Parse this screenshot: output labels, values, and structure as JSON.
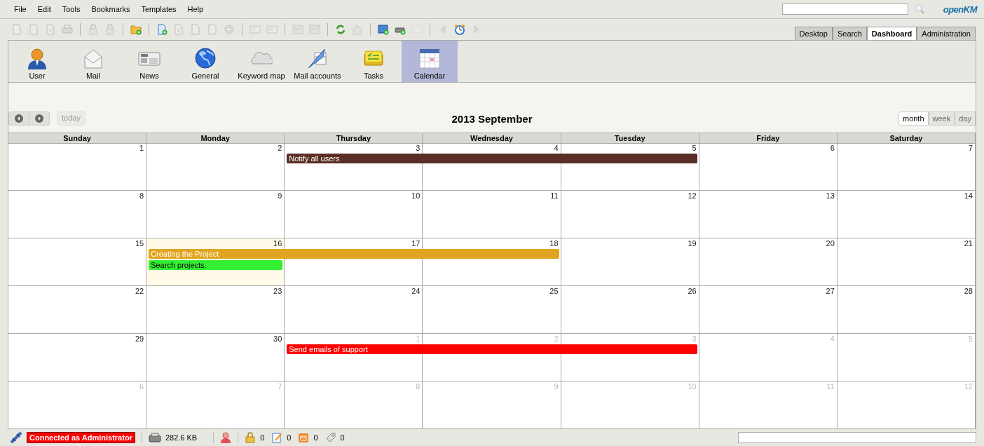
{
  "menu": [
    "File",
    "Edit",
    "Tools",
    "Bookmarks",
    "Templates",
    "Help"
  ],
  "logo": "openKM",
  "toolbar": {
    "groups": [
      [
        {
          "disabled": true
        },
        {
          "disabled": true
        },
        {
          "disabled": true
        },
        {
          "disabled": true
        }
      ],
      [
        {
          "disabled": true
        },
        {
          "disabled": true
        }
      ],
      [
        {
          "disabled": false
        }
      ],
      [
        {
          "disabled": false
        },
        {
          "disabled": true
        },
        {
          "disabled": true
        },
        {
          "disabled": true
        },
        {
          "disabled": true
        }
      ],
      [
        {
          "disabled": true
        },
        {
          "disabled": true
        }
      ],
      [
        {
          "disabled": true
        },
        {
          "disabled": true
        }
      ],
      [
        {
          "disabled": false
        },
        {
          "disabled": true
        }
      ],
      [
        {
          "disabled": false
        },
        {
          "disabled": false
        },
        {
          "disabled": true
        }
      ],
      [
        {
          "disabled": true
        },
        {
          "disabled": false
        },
        {
          "disabled": true
        }
      ]
    ]
  },
  "tabs": [
    {
      "label": "Desktop",
      "selected": false
    },
    {
      "label": "Search",
      "selected": false
    },
    {
      "label": "Dashboard",
      "selected": true
    },
    {
      "label": "Administration",
      "selected": false
    }
  ],
  "dashboard_tools": [
    {
      "label": "User",
      "kind": "user",
      "selected": false
    },
    {
      "label": "Mail",
      "kind": "mail",
      "selected": false
    },
    {
      "label": "News",
      "kind": "news",
      "selected": false
    },
    {
      "label": "General",
      "kind": "globe",
      "selected": false
    },
    {
      "label": "Keyword map",
      "kind": "cloud",
      "selected": false
    },
    {
      "label": "Mail accounts",
      "kind": "accounts",
      "selected": false
    },
    {
      "label": "Tasks",
      "kind": "tasks",
      "selected": false
    },
    {
      "label": "Calendar",
      "kind": "calendar",
      "selected": true
    }
  ],
  "calendar": {
    "today_button": {
      "label": "today",
      "disabled": true
    },
    "title": "2013 September",
    "views": [
      {
        "label": "month",
        "selected": true
      },
      {
        "label": "week",
        "selected": false
      },
      {
        "label": "day",
        "selected": false
      }
    ],
    "columns": [
      "Sunday",
      "Monday",
      "Thursday",
      "Wednesday",
      "Tuesday",
      "Friday",
      "Saturday"
    ],
    "weeks": [
      {
        "days": [
          {
            "label": "1",
            "other_month": false,
            "today": false
          },
          {
            "label": "2",
            "other_month": false,
            "today": false
          },
          {
            "label": "3",
            "other_month": false,
            "today": false
          },
          {
            "label": "4",
            "other_month": false,
            "today": false
          },
          {
            "label": "5",
            "other_month": false,
            "today": false
          },
          {
            "label": "6",
            "other_month": false,
            "today": false
          },
          {
            "label": "7",
            "other_month": false,
            "today": false
          }
        ],
        "events": [
          {
            "title": "Notify all users",
            "color": "#5a2e25",
            "on_days": [
              false,
              false,
              true,
              true,
              true,
              false,
              false
            ]
          }
        ]
      },
      {
        "days": [
          {
            "label": "8",
            "other_month": false,
            "today": false
          },
          {
            "label": "9",
            "other_month": false,
            "today": false
          },
          {
            "label": "10",
            "other_month": false,
            "today": false
          },
          {
            "label": "11",
            "other_month": false,
            "today": false
          },
          {
            "label": "12",
            "other_month": false,
            "today": false
          },
          {
            "label": "13",
            "other_month": false,
            "today": false
          },
          {
            "label": "14",
            "other_month": false,
            "today": false
          }
        ]
      },
      {
        "days": [
          {
            "label": "15",
            "other_month": false,
            "today": false
          },
          {
            "label": "16",
            "other_month": false,
            "today": true
          },
          {
            "label": "17",
            "other_month": false,
            "today": false
          },
          {
            "label": "18",
            "other_month": false,
            "today": false
          },
          {
            "label": "19",
            "other_month": false,
            "today": false
          },
          {
            "label": "20",
            "other_month": false,
            "today": false
          },
          {
            "label": "21",
            "other_month": false,
            "today": false
          }
        ],
        "events": [
          {
            "title": "Creating the Project",
            "color": "#e0a520",
            "on_days": [
              false,
              true,
              true,
              true,
              false,
              false,
              false
            ]
          },
          {
            "title": "Search projects.",
            "color": "#33ee33",
            "on_days": [
              false,
              true,
              false,
              false,
              false,
              false,
              false
            ]
          }
        ]
      },
      {
        "days": [
          {
            "label": "22",
            "other_month": false,
            "today": false
          },
          {
            "label": "23",
            "other_month": false,
            "today": false
          },
          {
            "label": "24",
            "other_month": false,
            "today": false
          },
          {
            "label": "25",
            "other_month": false,
            "today": false
          },
          {
            "label": "26",
            "other_month": false,
            "today": false
          },
          {
            "label": "27",
            "other_month": false,
            "today": false
          },
          {
            "label": "28",
            "other_month": false,
            "today": false
          }
        ]
      },
      {
        "days": [
          {
            "label": "29",
            "other_month": false,
            "today": false
          },
          {
            "label": "30",
            "other_month": false,
            "today": false
          },
          {
            "label": "1",
            "other_month": true,
            "today": false
          },
          {
            "label": "2",
            "other_month": true,
            "today": false
          },
          {
            "label": "3",
            "other_month": true,
            "today": false
          },
          {
            "label": "4",
            "other_month": true,
            "today": false
          },
          {
            "label": "5",
            "other_month": true,
            "today": false
          }
        ],
        "events": [
          {
            "title": "Send emails of support",
            "color": "#ff0000",
            "on_days": [
              false,
              false,
              true,
              true,
              true,
              false,
              false
            ]
          }
        ]
      },
      {
        "days": [
          {
            "label": "6",
            "other_month": true,
            "today": false
          },
          {
            "label": "7",
            "other_month": true,
            "today": false
          },
          {
            "label": "8",
            "other_month": true,
            "today": false
          },
          {
            "label": "9",
            "other_month": true,
            "today": false
          },
          {
            "label": "10",
            "other_month": true,
            "today": false
          },
          {
            "label": "11",
            "other_month": true,
            "today": false
          },
          {
            "label": "12",
            "other_month": true,
            "today": false
          }
        ]
      }
    ]
  },
  "status_bar": {
    "connection": "Connected as Administrator",
    "size": "282.6 KB",
    "counters": [
      {
        "kind": "locked",
        "value": "0"
      },
      {
        "kind": "checkout",
        "value": "0"
      },
      {
        "kind": "mail",
        "value": "0"
      },
      {
        "kind": "subscribed",
        "value": "0"
      }
    ]
  }
}
